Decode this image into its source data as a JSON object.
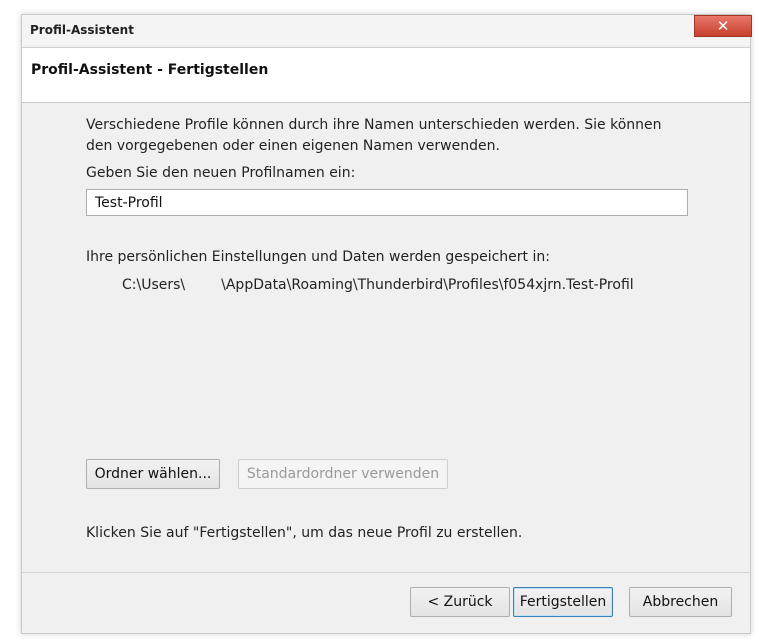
{
  "window": {
    "title": "Profil-Assistent",
    "close_glyph": "✕"
  },
  "header": {
    "heading": "Profil-Assistent - Fertigstellen"
  },
  "content": {
    "intro_line1": "Verschiedene Profile können durch ihre Namen unterschieden werden. Sie können",
    "intro_line2": "den vorgegebenen oder einen eigenen Namen verwenden.",
    "name_prompt": "Geben Sie den neuen Profilnamen ein:",
    "profile_name_value": "Test-Profil",
    "storage_label": "Ihre persönlichen Einstellungen und Daten werden gespeichert in:",
    "path_prefix": "C:\\Users\\",
    "path_suffix": "\\AppData\\Roaming\\Thunderbird\\Profiles\\f054xjrn.Test-Profil",
    "choose_folder_label": "Ordner wählen...",
    "default_folder_label": "Standardordner verwenden",
    "finish_hint": "Klicken Sie auf \"Fertigstellen\", um das neue Profil zu erstellen."
  },
  "footer": {
    "back_label": "< Zurück",
    "finish_label": "Fertigstellen",
    "cancel_label": "Abbrechen"
  },
  "colors": {
    "close_button": "#c7402e",
    "dialog_background": "#f0f0f0",
    "header_background": "#ffffff",
    "default_button_border": "#3c7fb1"
  },
  "icons": {
    "close": "close-icon"
  }
}
